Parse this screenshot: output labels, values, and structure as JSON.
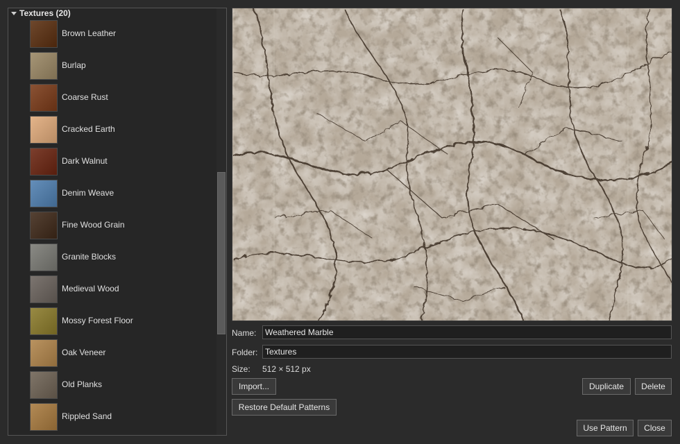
{
  "tree": {
    "header": "Textures (20)",
    "items": [
      {
        "label": "Brown Leather",
        "color": "#5a2e0f"
      },
      {
        "label": "Burlap",
        "color": "#9a8764"
      },
      {
        "label": "Coarse Rust",
        "color": "#7a3a18"
      },
      {
        "label": "Cracked Earth",
        "color": "#e0aa7a"
      },
      {
        "label": "Dark Walnut",
        "color": "#6a2410"
      },
      {
        "label": "Denim Weave",
        "color": "#4f7fb0"
      },
      {
        "label": "Fine Wood Grain",
        "color": "#3e2818"
      },
      {
        "label": "Granite Blocks",
        "color": "#7a7a74"
      },
      {
        "label": "Medieval Wood",
        "color": "#6a625c"
      },
      {
        "label": "Mossy Forest Floor",
        "color": "#8a7a2a"
      },
      {
        "label": "Oak Veneer",
        "color": "#b0844a"
      },
      {
        "label": "Old Planks",
        "color": "#6e6254"
      },
      {
        "label": "Rippled Sand",
        "color": "#a87a3e"
      }
    ]
  },
  "details": {
    "name_label": "Name:",
    "name_value": "Weathered Marble",
    "folder_label": "Folder:",
    "folder_value": "Textures",
    "size_label": "Size:",
    "size_value": "512 × 512 px"
  },
  "buttons": {
    "import": "Import...",
    "duplicate": "Duplicate",
    "delete": "Delete",
    "restore": "Restore Default Patterns",
    "use_pattern": "Use Pattern",
    "close": "Close"
  },
  "colors": {
    "background": "#2b2b2b",
    "marble_base": "#c9bfb2",
    "marble_vein": "#3a2e24"
  }
}
